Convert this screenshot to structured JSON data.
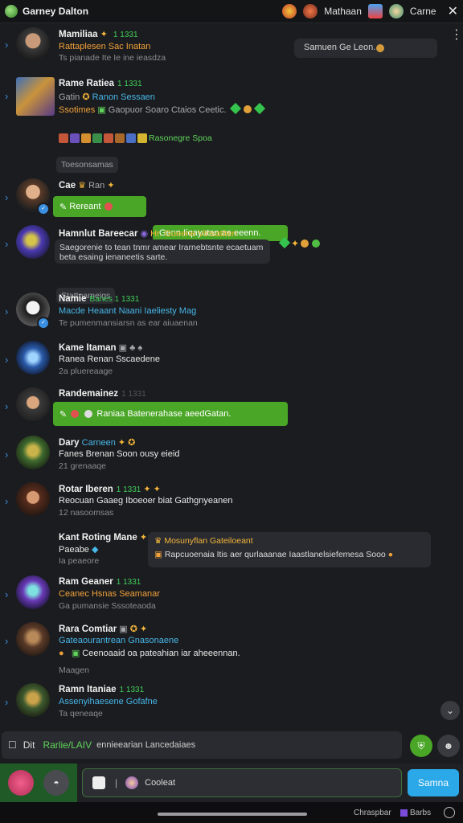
{
  "app": {
    "title": "Garney Dalton",
    "user_label": "Mathaan",
    "action_label": "Carne"
  },
  "colors": {
    "accent_green": "#4aa626",
    "send_blue": "#2aa8e8",
    "link_cyan": "#47b6e8",
    "level_green": "#3fcf5a"
  },
  "search": {
    "placeholder": "Samuen Ge Leon."
  },
  "messages": [
    {
      "name": "Mamiliaa",
      "level": "1 1331",
      "sub": "Rattaplesen Sac Inatan",
      "time": "Ts pianade Ite Ie ine ieasdza"
    },
    {
      "name": "Rame Ratiea",
      "level": "1 1331",
      "sub1": "Gatin",
      "sub2": "Ranon Sessaen",
      "tag": "Ssotimes",
      "rest": "Gaopuor Soaro Ctaios Ceetic.",
      "line3": "Rasonegre Spoa",
      "chip": "Toesonsamas"
    },
    {
      "name": "Cae",
      "sub": "Ran",
      "bubble": "Genn Iiqayutan ae eeenn.",
      "bubble_left": "Rereant"
    },
    {
      "name": "Hamnlut Bareecar",
      "tag": "Hr. Gueene Vinsatiten",
      "body": "Saegorenie to tean tnmr amear Irarnebtsnte ecaetuam beta esaing ienaneetis sarte.",
      "chip": "Stattnameigs"
    },
    {
      "name": "Namie",
      "level": "Banes 1 1331",
      "sub": "Macde Heaant Naani Iaeliesty Mag",
      "time": "Te pumenmansiarsn as ear aiuaenan"
    },
    {
      "name": "Kame Itaman",
      "sub": "Ranea Renan Sscaedene",
      "time": "2a pluereaage"
    },
    {
      "name": "Randemainez",
      "level": "1 1331",
      "bubble": "Raniaa Batenerahase aeedGatan."
    },
    {
      "name": "Dary",
      "level": "Carneen",
      "sub": "Fanes Brenan Soon ousy eieid",
      "time": "21 grenaaqe"
    },
    {
      "name": "Rotar Iberen",
      "level": "1 1331",
      "sub": "Reocuan Gaaeg Iboeoer biat Gathgnyeanen",
      "time": "12 nasoomsas"
    },
    {
      "name": "Kant Roting Mane",
      "sub": "Paeabe",
      "time": "Ia peaeore",
      "box_title": "Mosunyflan Gateiloeant",
      "box_body": "Rapcuoenaia Itis aer qurlaaanae Iaastlanelsiefemesa Sooo"
    },
    {
      "name": "Ram Geaner",
      "level": "1 1331",
      "sub": "Ceanec Hsnas Seamanar",
      "sub2": "Sssoteaoda",
      "time": "Ga pumansie"
    },
    {
      "name": "Rara Comtiar",
      "sub": "Gateaourantrean Gnasonaene",
      "body": "Ceenoaaid oa pateahian iar aheeennan.",
      "chip": "Maagen"
    },
    {
      "name": "Ramn Itaniae",
      "level": "1 1331",
      "sub": "Assenyihaesene Gofafne",
      "time": "Ta qeneaqe"
    }
  ],
  "command": {
    "prefix": "Dit",
    "highlight": "Rarlie/LAIV",
    "rest": "ennieearian Lancedaiaes"
  },
  "composer": {
    "placeholder": "Cooleat",
    "send_label": "Samna"
  },
  "status": {
    "left": "Chraspbar",
    "right": "Barbs"
  }
}
